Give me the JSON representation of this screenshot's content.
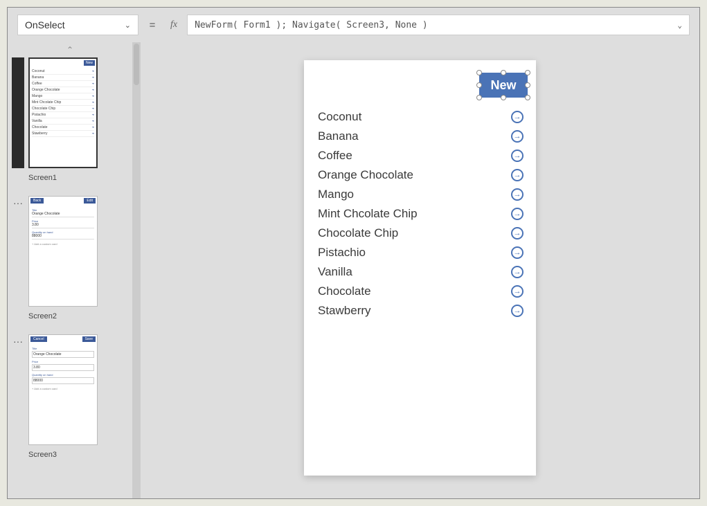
{
  "formula_bar": {
    "property": "OnSelect",
    "fx_label": "fx",
    "formula": "NewForm( Form1 ); Navigate( Screen3, None )"
  },
  "sidebar": {
    "thumb1": {
      "new_label": "New",
      "items": [
        "Coconut",
        "Banana",
        "Coffee",
        "Orange Chocolate",
        "Mango",
        "Mint Chcolate Chip",
        "Chocolate Chip",
        "Pistachio",
        "Vanilla",
        "Chocolate",
        "Stawberry"
      ],
      "label": "Screen1"
    },
    "thumb2": {
      "back": "Back",
      "edit": "Edit",
      "title_l": "Title",
      "title_v": "Orange Chocolate",
      "price_l": "Price",
      "price_v": "3.80",
      "qty_l": "Quantity on hand",
      "qty_v": "88000",
      "add": "+  Add a custom card",
      "label": "Screen2"
    },
    "thumb3": {
      "cancel": "Cancel",
      "save": "Save",
      "title_l": "Title",
      "title_v": "Orange Chocolate",
      "price_l": "Price",
      "price_v": "3.80",
      "qty_l": "Quantity on hand",
      "qty_v": "88000",
      "add": "+  Add a custom card",
      "label": "Screen3"
    }
  },
  "canvas": {
    "new_button": "New",
    "list": [
      "Coconut",
      "Banana",
      "Coffee",
      "Orange Chocolate",
      "Mango",
      "Mint Chcolate Chip",
      "Chocolate Chip",
      "Pistachio",
      "Vanilla",
      "Chocolate",
      "Stawberry"
    ]
  }
}
